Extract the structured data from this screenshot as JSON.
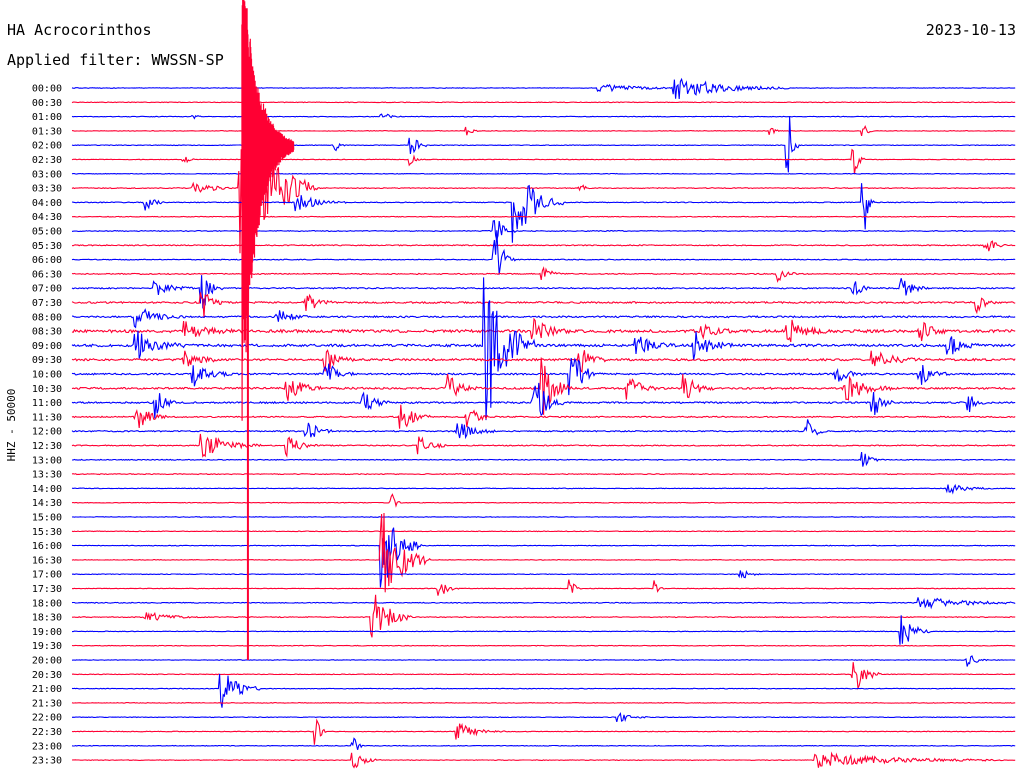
{
  "header": {
    "station": "HA Acrocorinthos",
    "date": "2023-10-13",
    "filter": "Applied filter: WWSSN-SP"
  },
  "side_label": "HHZ - 50000",
  "colors": {
    "even_rows": "#0000ff",
    "odd_rows": "#ff0033",
    "text": "#000000",
    "background": "#ffffff"
  },
  "chart_data": {
    "type": "line",
    "title": "HA Acrocorinthos",
    "subtitle": "Applied filter: WWSSN-SP",
    "date": "2023-10-13",
    "ylabel": "HHZ - 50000",
    "xlabel": "",
    "row_interval_minutes": 30,
    "row_labels": [
      "00:00",
      "00:30",
      "01:00",
      "01:30",
      "02:00",
      "02:30",
      "03:00",
      "03:30",
      "04:00",
      "04:30",
      "05:00",
      "05:30",
      "06:00",
      "06:30",
      "07:00",
      "07:30",
      "08:00",
      "08:30",
      "09:00",
      "09:30",
      "10:00",
      "10:30",
      "11:00",
      "11:30",
      "12:00",
      "12:30",
      "13:00",
      "13:30",
      "14:00",
      "14:30",
      "15:00",
      "15:30",
      "16:00",
      "16:30",
      "17:00",
      "17:30",
      "18:00",
      "18:30",
      "19:00",
      "19:30",
      "20:00",
      "20:30",
      "21:00",
      "21:30",
      "22:00",
      "22:30",
      "23:00",
      "23:30"
    ],
    "row_colors": "alternating blue (on the hour) / red (half hour)",
    "noise_level": [
      0.15,
      0.15,
      0.15,
      0.15,
      0.15,
      0.15,
      0.15,
      0.2,
      0.2,
      0.15,
      0.2,
      0.25,
      0.2,
      0.25,
      0.3,
      0.4,
      0.4,
      0.7,
      0.6,
      0.5,
      0.4,
      0.45,
      0.4,
      0.3,
      0.3,
      0.25,
      0.2,
      0.2,
      0.15,
      0.15,
      0.15,
      0.15,
      0.15,
      0.15,
      0.15,
      0.15,
      0.2,
      0.2,
      0.15,
      0.15,
      0.15,
      0.15,
      0.15,
      0.15,
      0.15,
      0.15,
      0.15,
      0.15
    ],
    "events": [
      {
        "row": 0,
        "x": 0.56,
        "amp": 4,
        "len": 0.1
      },
      {
        "row": 0,
        "x": 0.64,
        "amp": 12,
        "len": 0.12
      },
      {
        "row": 2,
        "x": 0.13,
        "amp": 4,
        "len": 0.01
      },
      {
        "row": 2,
        "x": 0.33,
        "amp": 4,
        "len": 0.02
      },
      {
        "row": 3,
        "x": 0.42,
        "amp": 5,
        "len": 0.01
      },
      {
        "row": 3,
        "x": 0.74,
        "amp": 5,
        "len": 0.01
      },
      {
        "row": 3,
        "x": 0.84,
        "amp": 5,
        "len": 0.01
      },
      {
        "row": 4,
        "x": 0.28,
        "amp": 5,
        "len": 0.01
      },
      {
        "row": 4,
        "x": 0.36,
        "amp": 10,
        "len": 0.02
      },
      {
        "row": 4,
        "x": 0.76,
        "amp": 40,
        "len": 0.01
      },
      {
        "row": 5,
        "x": 0.12,
        "amp": 4,
        "len": 0.01
      },
      {
        "row": 5,
        "x": 0.36,
        "amp": 6,
        "len": 0.01
      },
      {
        "row": 5,
        "x": 0.83,
        "amp": 15,
        "len": 0.01
      },
      {
        "row": 7,
        "x": 0.13,
        "amp": 5,
        "len": 0.06
      },
      {
        "row": 7,
        "x": 0.18,
        "amp": 90,
        "len": 0.08
      },
      {
        "row": 7,
        "x": 0.54,
        "amp": 4,
        "len": 0.01
      },
      {
        "row": 8,
        "x": 0.08,
        "amp": 8,
        "len": 0.02
      },
      {
        "row": 8,
        "x": 0.24,
        "amp": 9,
        "len": 0.05
      },
      {
        "row": 8,
        "x": 0.47,
        "amp": 40,
        "len": 0.05
      },
      {
        "row": 8,
        "x": 0.84,
        "amp": 30,
        "len": 0.01
      },
      {
        "row": 10,
        "x": 0.45,
        "amp": 15,
        "len": 0.02
      },
      {
        "row": 11,
        "x": 0.97,
        "amp": 6,
        "len": 0.03
      },
      {
        "row": 12,
        "x": 0.45,
        "amp": 30,
        "len": 0.02
      },
      {
        "row": 13,
        "x": 0.5,
        "amp": 8,
        "len": 0.02
      },
      {
        "row": 13,
        "x": 0.75,
        "amp": 8,
        "len": 0.02
      },
      {
        "row": 14,
        "x": 0.09,
        "amp": 8,
        "len": 0.04
      },
      {
        "row": 14,
        "x": 0.14,
        "amp": 20,
        "len": 0.02
      },
      {
        "row": 14,
        "x": 0.83,
        "amp": 8,
        "len": 0.02
      },
      {
        "row": 14,
        "x": 0.88,
        "amp": 10,
        "len": 0.03
      },
      {
        "row": 15,
        "x": 0.14,
        "amp": 15,
        "len": 0.02
      },
      {
        "row": 15,
        "x": 0.25,
        "amp": 10,
        "len": 0.03
      },
      {
        "row": 15,
        "x": 0.96,
        "amp": 10,
        "len": 0.02
      },
      {
        "row": 16,
        "x": 0.07,
        "amp": 10,
        "len": 0.05
      },
      {
        "row": 16,
        "x": 0.22,
        "amp": 8,
        "len": 0.03
      },
      {
        "row": 17,
        "x": 0.12,
        "amp": 10,
        "len": 0.05
      },
      {
        "row": 17,
        "x": 0.49,
        "amp": 12,
        "len": 0.04
      },
      {
        "row": 17,
        "x": 0.67,
        "amp": 8,
        "len": 0.03
      },
      {
        "row": 17,
        "x": 0.76,
        "amp": 12,
        "len": 0.04
      },
      {
        "row": 17,
        "x": 0.9,
        "amp": 10,
        "len": 0.03
      },
      {
        "row": 18,
        "x": 0.07,
        "amp": 14,
        "len": 0.05
      },
      {
        "row": 18,
        "x": 0.44,
        "amp": 80,
        "len": 0.05
      },
      {
        "row": 18,
        "x": 0.6,
        "amp": 12,
        "len": 0.04
      },
      {
        "row": 18,
        "x": 0.66,
        "amp": 14,
        "len": 0.04
      },
      {
        "row": 18,
        "x": 0.93,
        "amp": 12,
        "len": 0.03
      },
      {
        "row": 19,
        "x": 0.12,
        "amp": 10,
        "len": 0.04
      },
      {
        "row": 19,
        "x": 0.27,
        "amp": 12,
        "len": 0.03
      },
      {
        "row": 19,
        "x": 0.54,
        "amp": 12,
        "len": 0.03
      },
      {
        "row": 19,
        "x": 0.85,
        "amp": 10,
        "len": 0.05
      },
      {
        "row": 20,
        "x": 0.13,
        "amp": 12,
        "len": 0.04
      },
      {
        "row": 20,
        "x": 0.27,
        "amp": 12,
        "len": 0.03
      },
      {
        "row": 20,
        "x": 0.53,
        "amp": 25,
        "len": 0.03
      },
      {
        "row": 20,
        "x": 0.81,
        "amp": 10,
        "len": 0.03
      },
      {
        "row": 20,
        "x": 0.9,
        "amp": 12,
        "len": 0.03
      },
      {
        "row": 21,
        "x": 0.23,
        "amp": 12,
        "len": 0.04
      },
      {
        "row": 21,
        "x": 0.4,
        "amp": 14,
        "len": 0.03
      },
      {
        "row": 21,
        "x": 0.5,
        "amp": 30,
        "len": 0.03
      },
      {
        "row": 21,
        "x": 0.59,
        "amp": 14,
        "len": 0.03
      },
      {
        "row": 21,
        "x": 0.65,
        "amp": 14,
        "len": 0.03
      },
      {
        "row": 21,
        "x": 0.82,
        "amp": 14,
        "len": 0.05
      },
      {
        "row": 22,
        "x": 0.09,
        "amp": 16,
        "len": 0.02
      },
      {
        "row": 22,
        "x": 0.31,
        "amp": 10,
        "len": 0.03
      },
      {
        "row": 22,
        "x": 0.49,
        "amp": 30,
        "len": 0.03
      },
      {
        "row": 22,
        "x": 0.85,
        "amp": 16,
        "len": 0.02
      },
      {
        "row": 22,
        "x": 0.95,
        "amp": 12,
        "len": 0.02
      },
      {
        "row": 23,
        "x": 0.07,
        "amp": 14,
        "len": 0.03
      },
      {
        "row": 23,
        "x": 0.35,
        "amp": 14,
        "len": 0.03
      },
      {
        "row": 23,
        "x": 0.42,
        "amp": 10,
        "len": 0.03
      },
      {
        "row": 24,
        "x": 0.25,
        "amp": 10,
        "len": 0.03
      },
      {
        "row": 24,
        "x": 0.41,
        "amp": 10,
        "len": 0.04
      },
      {
        "row": 24,
        "x": 0.78,
        "amp": 12,
        "len": 0.02
      },
      {
        "row": 25,
        "x": 0.14,
        "amp": 14,
        "len": 0.06
      },
      {
        "row": 25,
        "x": 0.23,
        "amp": 10,
        "len": 0.03
      },
      {
        "row": 25,
        "x": 0.37,
        "amp": 10,
        "len": 0.03
      },
      {
        "row": 26,
        "x": 0.84,
        "amp": 8,
        "len": 0.02
      },
      {
        "row": 28,
        "x": 0.93,
        "amp": 5,
        "len": 0.05
      },
      {
        "row": 29,
        "x": 0.34,
        "amp": 8,
        "len": 0.01
      },
      {
        "row": 32,
        "x": 0.33,
        "amp": 45,
        "len": 0.04
      },
      {
        "row": 33,
        "x": 0.33,
        "amp": 50,
        "len": 0.05
      },
      {
        "row": 34,
        "x": 0.71,
        "amp": 5,
        "len": 0.02
      },
      {
        "row": 35,
        "x": 0.39,
        "amp": 10,
        "len": 0.02
      },
      {
        "row": 35,
        "x": 0.53,
        "amp": 10,
        "len": 0.01
      },
      {
        "row": 35,
        "x": 0.62,
        "amp": 8,
        "len": 0.01
      },
      {
        "row": 36,
        "x": 0.9,
        "amp": 6,
        "len": 0.12
      },
      {
        "row": 37,
        "x": 0.08,
        "amp": 5,
        "len": 0.06
      },
      {
        "row": 37,
        "x": 0.32,
        "amp": 30,
        "len": 0.04
      },
      {
        "row": 38,
        "x": 0.88,
        "amp": 20,
        "len": 0.03
      },
      {
        "row": 40,
        "x": 0.95,
        "amp": 8,
        "len": 0.02
      },
      {
        "row": 41,
        "x": 0.83,
        "amp": 18,
        "len": 0.03
      },
      {
        "row": 42,
        "x": 0.16,
        "amp": 22,
        "len": 0.04
      },
      {
        "row": 44,
        "x": 0.58,
        "amp": 5,
        "len": 0.03
      },
      {
        "row": 45,
        "x": 0.26,
        "amp": 15,
        "len": 0.01
      },
      {
        "row": 45,
        "x": 0.41,
        "amp": 8,
        "len": 0.05
      },
      {
        "row": 46,
        "x": 0.3,
        "amp": 8,
        "len": 0.01
      },
      {
        "row": 47,
        "x": 0.3,
        "amp": 8,
        "len": 0.03
      },
      {
        "row": 47,
        "x": 0.79,
        "amp": 8,
        "len": 0.2
      }
    ],
    "big_event": {
      "row": 4,
      "x": 0.18,
      "amp_up": 200,
      "amp_down": 280,
      "tail_rows": 40,
      "len": 0.05
    }
  }
}
